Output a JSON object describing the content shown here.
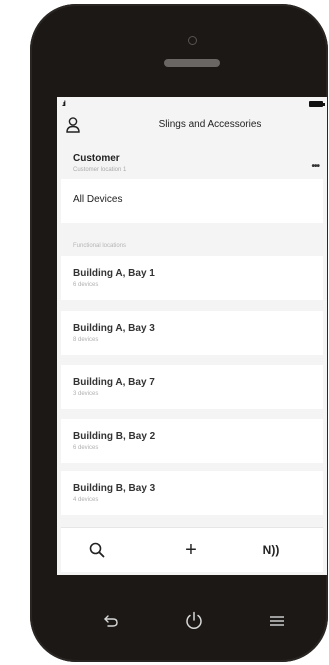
{
  "statusbar": {
    "signal": ".ıl"
  },
  "header": {
    "title": "Slings and Accessories",
    "user_icon": "user-icon"
  },
  "customer": {
    "name": "Customer",
    "location": "Customer location 1",
    "more_label": "•••"
  },
  "all_devices": {
    "label": "All Devices"
  },
  "functional_locations": {
    "section_label": "Functional locations",
    "items": [
      {
        "title": "Building A, Bay 1",
        "devices": "6 devices"
      },
      {
        "title": "Building A, Bay 3",
        "devices": "8 devices"
      },
      {
        "title": "Building A, Bay 7",
        "devices": "3 devices"
      },
      {
        "title": "Building B, Bay 2",
        "devices": "6 devices"
      },
      {
        "title": "Building B, Bay 3",
        "devices": "4 devices"
      }
    ]
  },
  "toolbar": {
    "add_label": "+",
    "nfc_label": "N))"
  },
  "colors": {
    "phone_body": "#1b1816",
    "screen_bg": "#f4f4f4",
    "card_bg": "#ffffff"
  }
}
